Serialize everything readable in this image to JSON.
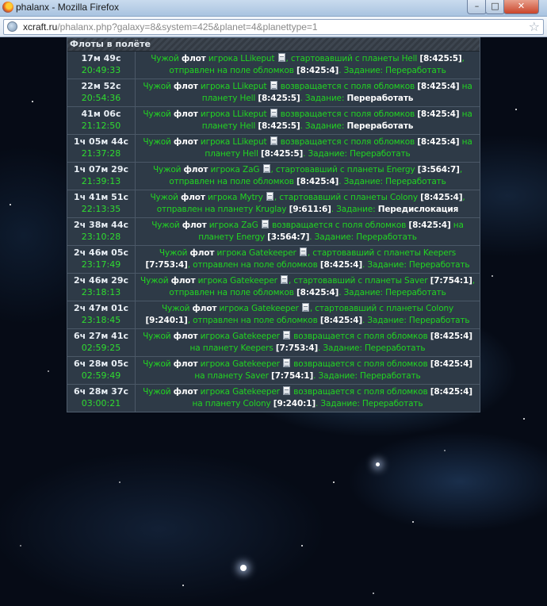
{
  "window": {
    "title": "phalanx - Mozilla Firefox",
    "minimize": "–",
    "maximize": "□",
    "close": "✕"
  },
  "address": {
    "domain": "xcraft.ru",
    "path": "/phalanx.php?galaxy=8&system=425&planet=4&planettype=1"
  },
  "panel": {
    "title": "Флоты в полёте"
  },
  "fleets": [
    {
      "duration": "17м 49с",
      "time": "20:49:33",
      "a": "Чужой ",
      "b": "флот",
      "c": " игрока LLikeput ",
      "icon": true,
      "d": ", стартовавший с планеты Hell ",
      "e": "[8:425:5]",
      "f": ",",
      "g": " отправлен на поле обломков ",
      "h": "[8:425:4]",
      "i": ". Задание: Переработать",
      "j": ""
    },
    {
      "duration": "22м 52с",
      "time": "20:54:36",
      "a": "Чужой ",
      "b": "флот",
      "c": " игрока LLikeput ",
      "icon": true,
      "d": " возвращается с поля обломков ",
      "e": "[8:425:4]",
      "f": " на",
      "g": " планету Hell ",
      "h": "[8:425:5]",
      "i": ". Задание: ",
      "j": "Переработать"
    },
    {
      "duration": "41м 06с",
      "time": "21:12:50",
      "a": "Чужой ",
      "b": "флот",
      "c": " игрока LLikeput ",
      "icon": true,
      "d": " возвращается с поля обломков ",
      "e": "[8:425:4]",
      "f": " на",
      "g": " планету Hell ",
      "h": "[8:425:5]",
      "i": ". Задание: ",
      "j": "Переработать"
    },
    {
      "duration": "1ч 05м 44с",
      "time": "21:37:28",
      "a": "Чужой ",
      "b": "флот",
      "c": " игрока LLikeput ",
      "icon": true,
      "d": " возвращается с поля обломков ",
      "e": "[8:425:4]",
      "f": " на",
      "g": " планету Hell ",
      "h": "[8:425:5]",
      "i": ". Задание: Переработать",
      "j": ""
    },
    {
      "duration": "1ч 07м 29с",
      "time": "21:39:13",
      "a": "Чужой ",
      "b": "флот",
      "c": " игрока ZaG ",
      "icon": true,
      "d": ", стартовавший с планеты Energy ",
      "e": "[3:564:7]",
      "f": ",",
      "g": " отправлен на поле обломков ",
      "h": "[8:425:4]",
      "i": ". Задание: Переработать",
      "j": ""
    },
    {
      "duration": "1ч 41м 51с",
      "time": "22:13:35",
      "a": "Чужой ",
      "b": "флот",
      "c": " игрока Mytry ",
      "icon": true,
      "d": ", стартовавший с планеты Colony ",
      "e": "[8:425:4]",
      "f": ",",
      "g": " отправлен на планету Kruglay ",
      "h": "[9:611:6]",
      "i": ". Задание: ",
      "j": "Передислокация"
    },
    {
      "duration": "2ч 38м 44с",
      "time": "23:10:28",
      "a": "Чужой ",
      "b": "флот",
      "c": " игрока ZaG ",
      "icon": true,
      "d": " возвращается с поля обломков ",
      "e": "[8:425:4]",
      "f": " на планету",
      "g": " Energy ",
      "h": "[3:564:7]",
      "i": ". Задание: Переработать",
      "j": ""
    },
    {
      "duration": "2ч 46м 05с",
      "time": "23:17:49",
      "a": "Чужой ",
      "b": "флот",
      "c": " игрока Gatekeeper ",
      "icon": true,
      "d": ", стартовавший с планеты Keepers ",
      "e": "[7:753:4]",
      "f": ",",
      "g": " отправлен на поле обломков ",
      "h": "[8:425:4]",
      "i": ". Задание: Переработать",
      "j": ""
    },
    {
      "duration": "2ч 46м 29с",
      "time": "23:18:13",
      "a": "Чужой ",
      "b": "флот",
      "c": " игрока Gatekeeper ",
      "icon": true,
      "d": ", стартовавший с планеты Saver ",
      "e": "[7:754:1]",
      "f": ",",
      "g": " отправлен на поле обломков ",
      "h": "[8:425:4]",
      "i": ". Задание: Переработать",
      "j": ""
    },
    {
      "duration": "2ч 47м 01с",
      "time": "23:18:45",
      "a": "Чужой ",
      "b": "флот",
      "c": " игрока Gatekeeper ",
      "icon": true,
      "d": ", стартовавший с планеты Colony ",
      "e": "[9:240:1]",
      "f": ",",
      "g": " отправлен на поле обломков ",
      "h": "[8:425:4]",
      "i": ". Задание: Переработать",
      "j": ""
    },
    {
      "duration": "6ч 27м 41с",
      "time": "02:59:25",
      "a": "Чужой ",
      "b": "флот",
      "c": " игрока Gatekeeper ",
      "icon": true,
      "d": " возвращается с поля обломков ",
      "e": "[8:425:4]",
      "f": " на",
      "g": " планету Keepers ",
      "h": "[7:753:4]",
      "i": ". Задание: Переработать",
      "j": ""
    },
    {
      "duration": "6ч 28м 05с",
      "time": "02:59:49",
      "a": "Чужой ",
      "b": "флот",
      "c": " игрока Gatekeeper ",
      "icon": true,
      "d": " возвращается с поля обломков ",
      "e": "[8:425:4]",
      "f": " на",
      "g": " планету Saver ",
      "h": "[7:754:1]",
      "i": ". Задание: Переработать",
      "j": ""
    },
    {
      "duration": "6ч 28м 37с",
      "time": "03:00:21",
      "a": "Чужой ",
      "b": "флот",
      "c": " игрока Gatekeeper ",
      "icon": true,
      "d": " возвращается с поля обломков ",
      "e": "[8:425:4]",
      "f": " на",
      "g": " планету Colony ",
      "h": "[9:240:1]",
      "i": ". Задание: Переработать",
      "j": ""
    }
  ]
}
